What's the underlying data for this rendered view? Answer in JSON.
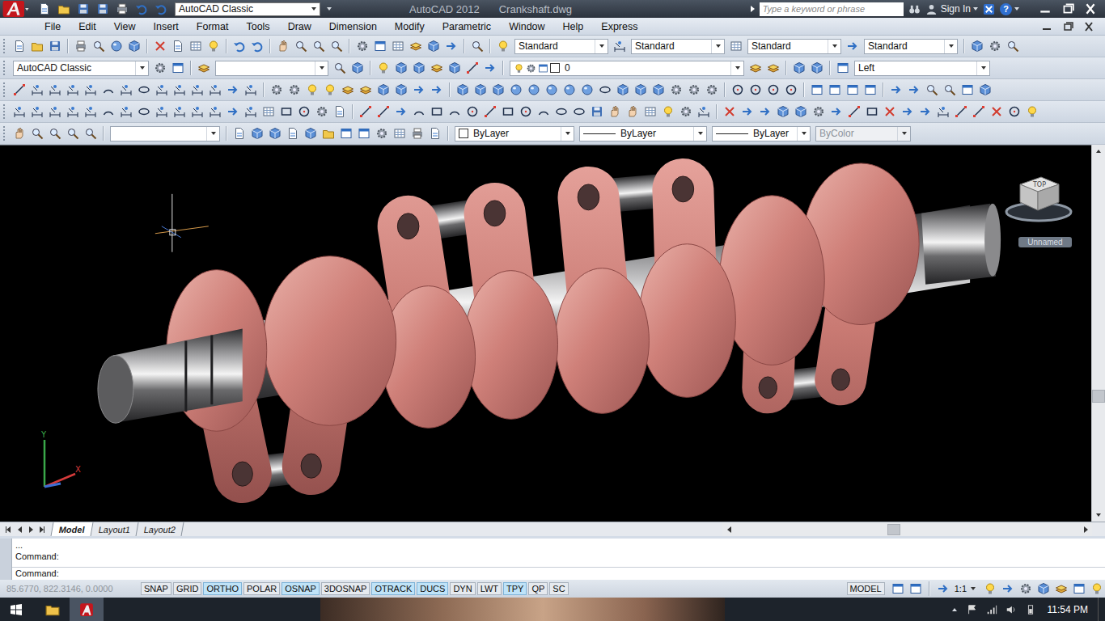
{
  "window": {
    "app_title": "AutoCAD 2012",
    "document": "Crankshaft.dwg",
    "workspace": "AutoCAD Classic",
    "search_placeholder": "Type a keyword or phrase",
    "sign_in": "Sign In",
    "help": "?"
  },
  "menu": [
    "File",
    "Edit",
    "View",
    "Insert",
    "Format",
    "Tools",
    "Draw",
    "Dimension",
    "Modify",
    "Parametric",
    "Window",
    "Help",
    "Express"
  ],
  "toolbars": {
    "text_style": "Standard",
    "dimension_style": "Standard",
    "table_style": "Standard",
    "multileader_style": "Standard",
    "workspace": "AutoCAD Classic",
    "layer": "0",
    "view": "Left",
    "color": "ByLayer",
    "linetype": "ByLayer",
    "lineweight": "ByLayer",
    "plot_style": {
      "label": "ByColor",
      "disabled": true
    }
  },
  "viewport": {
    "viewcube_face": "TOP",
    "ucs_menu": "Unnamed",
    "ucs_axes": {
      "y": "Y",
      "x": "X"
    }
  },
  "layout_tabs": [
    {
      "label": "Model",
      "selected": true
    },
    {
      "label": "Layout1",
      "selected": false
    },
    {
      "label": "Layout2",
      "selected": false
    }
  ],
  "command_line": {
    "history": [
      "...",
      "Command:"
    ],
    "prompt": "Command:"
  },
  "status_bar": {
    "coordinates": "85.6770, 822.3146, 0.0000",
    "coordinates_greyed": true,
    "toggles": [
      {
        "label": "SNAP",
        "on": false
      },
      {
        "label": "GRID",
        "on": false
      },
      {
        "label": "ORTHO",
        "on": true
      },
      {
        "label": "POLAR",
        "on": false
      },
      {
        "label": "OSNAP",
        "on": true
      },
      {
        "label": "3DOSNAP",
        "on": false
      },
      {
        "label": "OTRACK",
        "on": true
      },
      {
        "label": "DUCS",
        "on": true
      },
      {
        "label": "DYN",
        "on": false
      },
      {
        "label": "LWT",
        "on": false
      },
      {
        "label": "TPY",
        "on": true
      },
      {
        "label": "QP",
        "on": false
      },
      {
        "label": "SC",
        "on": false
      }
    ],
    "space": "MODEL",
    "annotation_scale": "1:1"
  },
  "taskbar": {
    "time": "11:54 PM"
  }
}
